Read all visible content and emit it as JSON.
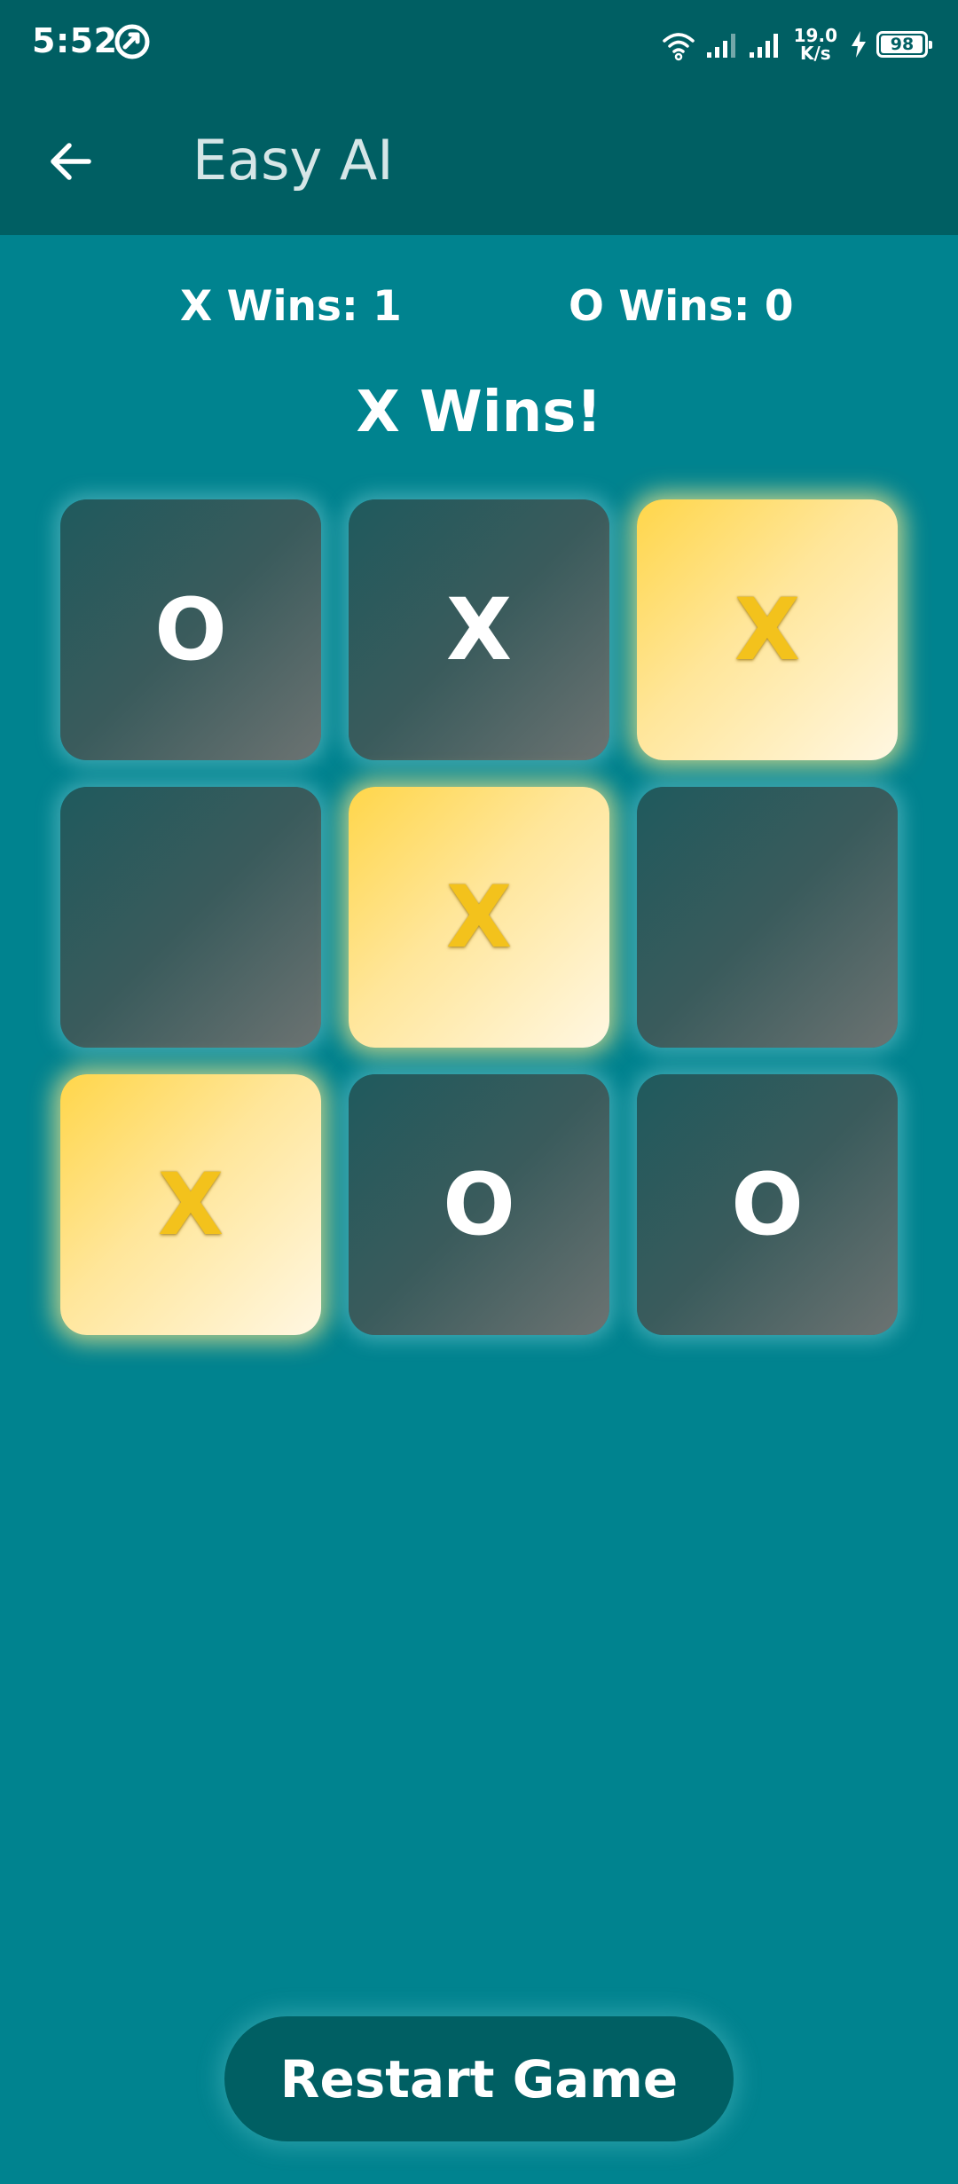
{
  "status_bar": {
    "time": "5:52",
    "net_speed_value": "19.0",
    "net_speed_unit": "K/s",
    "battery_level": "98",
    "battery_fraction": 0.98
  },
  "app_bar": {
    "title": "Easy AI",
    "back_icon": "arrow-left-icon"
  },
  "scoreboard": {
    "x_score": "X Wins: 1",
    "o_score": "O Wins: 0"
  },
  "game_status": "X Wins!",
  "board": {
    "cells": [
      {
        "mark": "O",
        "winning": false
      },
      {
        "mark": "X",
        "winning": false
      },
      {
        "mark": "X",
        "winning": true
      },
      {
        "mark": "",
        "winning": false
      },
      {
        "mark": "X",
        "winning": true
      },
      {
        "mark": "",
        "winning": false
      },
      {
        "mark": "X",
        "winning": true
      },
      {
        "mark": "O",
        "winning": false
      },
      {
        "mark": "O",
        "winning": false
      }
    ]
  },
  "restart_label": "Restart Game",
  "colors": {
    "background": "#00838f",
    "app_bar": "#005f63",
    "win_gold": "#f3c21c"
  }
}
